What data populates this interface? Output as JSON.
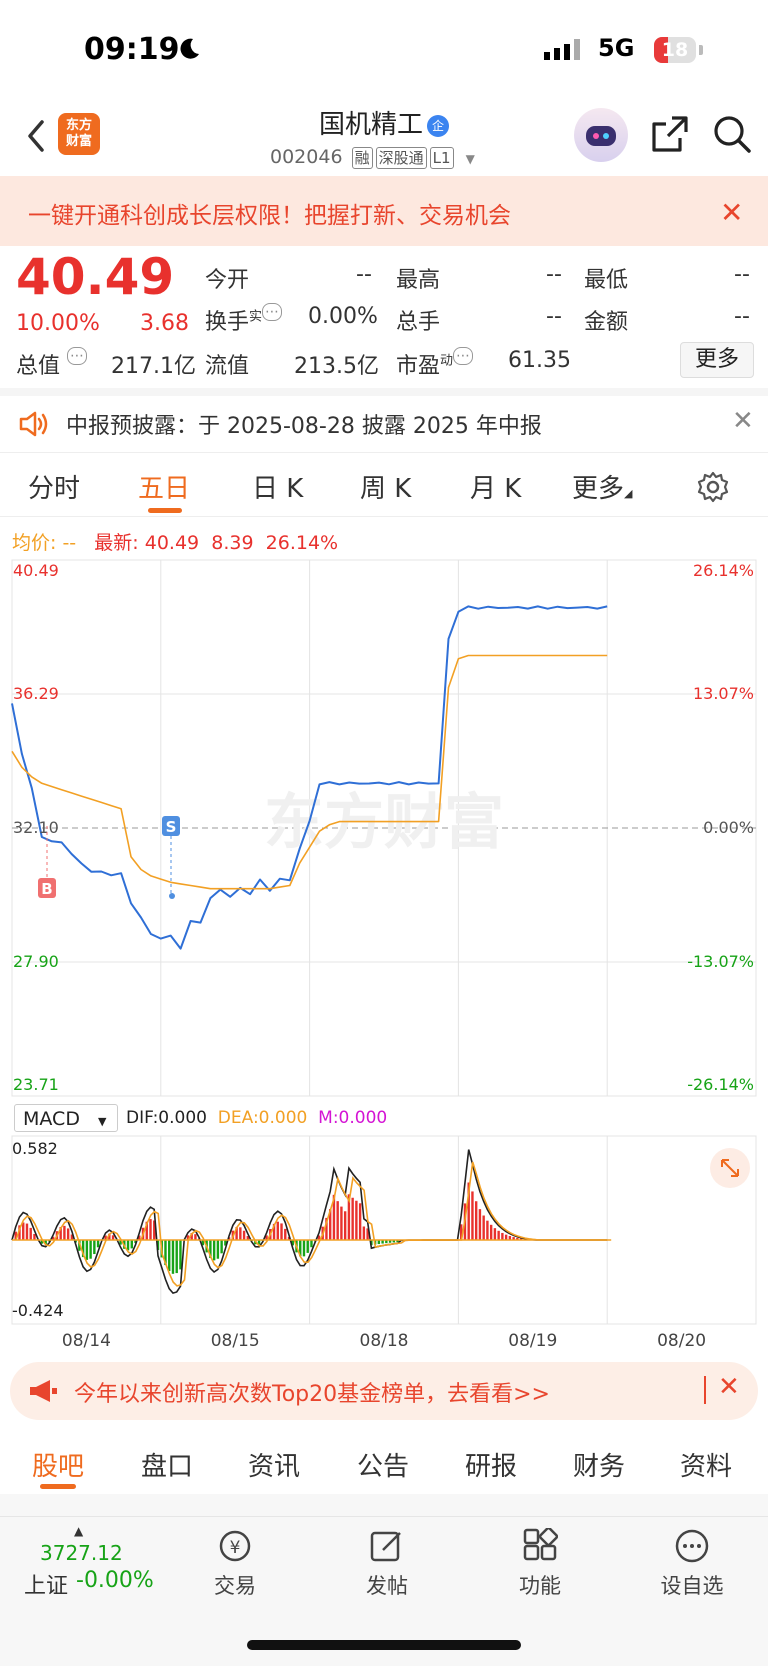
{
  "status": {
    "time": "09:19",
    "network": "5G",
    "battery": "18"
  },
  "header": {
    "logo_text": "东方财富",
    "title": "国机精工",
    "title_badge": "企",
    "code": "002046",
    "tags": [
      "融",
      "深股通",
      "L1"
    ]
  },
  "banner": {
    "text": "一键开通科创成长层权限！把握打新、交易机会"
  },
  "quote": {
    "price": "40.49",
    "change_pct": "10.00%",
    "change": "3.68",
    "open_label": "今开",
    "open": "--",
    "high_label": "最高",
    "high": "--",
    "low_label": "最低",
    "low": "--",
    "turnover_label": "换手",
    "turnover_sup": "实",
    "turnover": "0.00%",
    "volume_label": "总手",
    "volume": "--",
    "amount_label": "金额",
    "amount": "--",
    "mktcap_label": "总值",
    "mktcap": "217.1亿",
    "float_label": "流值",
    "float": "213.5亿",
    "pe_label": "市盈",
    "pe_sup": "动",
    "pe": "61.35",
    "more": "更多"
  },
  "notice": {
    "text": "中报预披露：于 2025-08-28 披露 2025 年中报"
  },
  "tabs": [
    "分时",
    "五日",
    "日 K",
    "周 K",
    "月 K",
    "更多"
  ],
  "active_tab": "五日",
  "legend": {
    "avg_label": "均价:",
    "avg_value": "--",
    "latest_label": "最新:",
    "latest_price": "40.49",
    "latest_change": "8.39",
    "latest_pct": "26.14%"
  },
  "watermark": "东方财富",
  "chart_data": {
    "type": "line",
    "x_labels": [
      "08/14",
      "08/15",
      "08/18",
      "08/19",
      "08/20"
    ],
    "y_ticks_left": [
      "40.49",
      "36.29",
      "32.10",
      "27.90",
      "23.71"
    ],
    "y_ticks_right": [
      "26.14%",
      "13.07%",
      "0.00%",
      "-13.07%",
      "-26.14%"
    ],
    "ylim": [
      23.71,
      40.49
    ],
    "prev_close": 32.1,
    "series": [
      {
        "name": "价格",
        "color": "#2f6fd6",
        "values": [
          36.0,
          34.5,
          33.2,
          32.0,
          31.5,
          31.8,
          31.2,
          31.0,
          30.8,
          30.6,
          30.8,
          30.5,
          29.9,
          29.2,
          28.8,
          28.7,
          28.6,
          28.5,
          29.0,
          29.3,
          29.8,
          30.2,
          30.0,
          30.1,
          30.2,
          30.3,
          30.3,
          30.4,
          30.5,
          31.5,
          32.3,
          33.5,
          33.5,
          33.5,
          33.5,
          33.5,
          33.5,
          33.5,
          33.5,
          33.5,
          33.5,
          33.5,
          33.5,
          33.5,
          38.0,
          38.9,
          39.0,
          39.0,
          39.0,
          39.0,
          39.0,
          39.0,
          39.0,
          39.0,
          39.0,
          39.0,
          39.0,
          39.0,
          39.0,
          39.0,
          39.0
        ]
      },
      {
        "name": "均价",
        "color": "#f2a024",
        "values": [
          34.5,
          34.0,
          33.7,
          33.5,
          33.4,
          33.3,
          33.2,
          33.1,
          33.0,
          32.9,
          32.8,
          32.7,
          31.2,
          30.8,
          30.6,
          30.5,
          30.4,
          30.35,
          30.3,
          30.25,
          30.2,
          30.2,
          30.2,
          30.2,
          30.2,
          30.2,
          30.2,
          30.25,
          30.3,
          31.0,
          31.5,
          32.0,
          32.2,
          32.3,
          32.3,
          32.3,
          32.3,
          32.3,
          32.3,
          32.3,
          32.3,
          32.3,
          32.3,
          32.3,
          36.5,
          37.4,
          37.5,
          37.5,
          37.5,
          37.5,
          37.5,
          37.5,
          37.5,
          37.5,
          37.5,
          37.5,
          37.5,
          37.5,
          37.5,
          37.5,
          37.5
        ]
      }
    ],
    "markers": [
      {
        "label": "B",
        "color": "#f07070"
      },
      {
        "label": "S",
        "color": "#4f8fe0"
      }
    ]
  },
  "macd": {
    "selector": "MACD",
    "dif": "DIF:0.000",
    "dea": "DEA:0.000",
    "m": "M:0.000",
    "ymax": "0.582",
    "ymin": "-0.424"
  },
  "promo": {
    "text": "今年以来创新高次数Top20基金榜单，去看看>>"
  },
  "bottom_tabs": [
    "股吧",
    "盘口",
    "资讯",
    "公告",
    "研报",
    "财务",
    "资料"
  ],
  "active_bottom_tab": "股吧",
  "nav": {
    "index_value": "3727.12",
    "index_name": "上证",
    "index_change": "-0.00%",
    "items": [
      "交易",
      "发帖",
      "功能",
      "设自选"
    ]
  },
  "colors": {
    "up": "#e8312d",
    "down": "#17a317",
    "accent": "#ef6b1f",
    "price_line": "#2f6fd6",
    "avg_line": "#f2a024"
  }
}
